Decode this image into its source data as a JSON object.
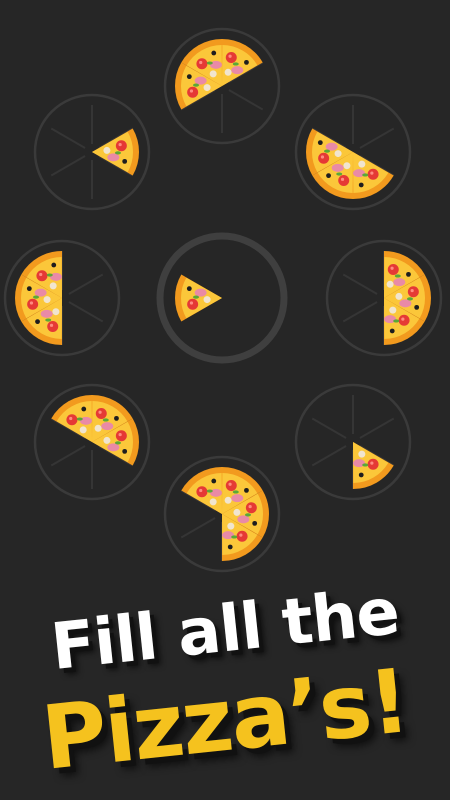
{
  "caption": {
    "line1": "Fill all the",
    "line2": "Pizza’s!"
  },
  "colors": {
    "background": "#262626",
    "plate_ring": "#3a3a3a",
    "center_ring": "#3f3f3f",
    "crust": "#f29a1e",
    "cheese": "#fbc73a",
    "tomato": "#e53935",
    "ham": "#e98aa6",
    "mushroom": "#f1e5cf",
    "olive": "#1e1e1e",
    "basil": "#5aa838",
    "caption_white": "#ffffff",
    "caption_yellow": "#f5c21e"
  },
  "plates": [
    {
      "id": "top",
      "slices_filled": [
        0,
        4,
        5
      ]
    },
    {
      "id": "upper-left",
      "slices_filled": [
        1
      ]
    },
    {
      "id": "upper-right",
      "slices_filled": [
        2,
        3,
        4
      ]
    },
    {
      "id": "middle-left",
      "slices_filled": [
        3,
        4,
        5
      ]
    },
    {
      "id": "center",
      "slices_filled": [
        4
      ]
    },
    {
      "id": "middle-right",
      "slices_filled": [
        0,
        1,
        2
      ]
    },
    {
      "id": "lower-left",
      "slices_filled": [
        5,
        0,
        1
      ]
    },
    {
      "id": "lower-right",
      "slices_filled": [
        2
      ]
    },
    {
      "id": "bottom",
      "slices_filled": [
        5,
        0,
        1,
        2
      ]
    }
  ]
}
